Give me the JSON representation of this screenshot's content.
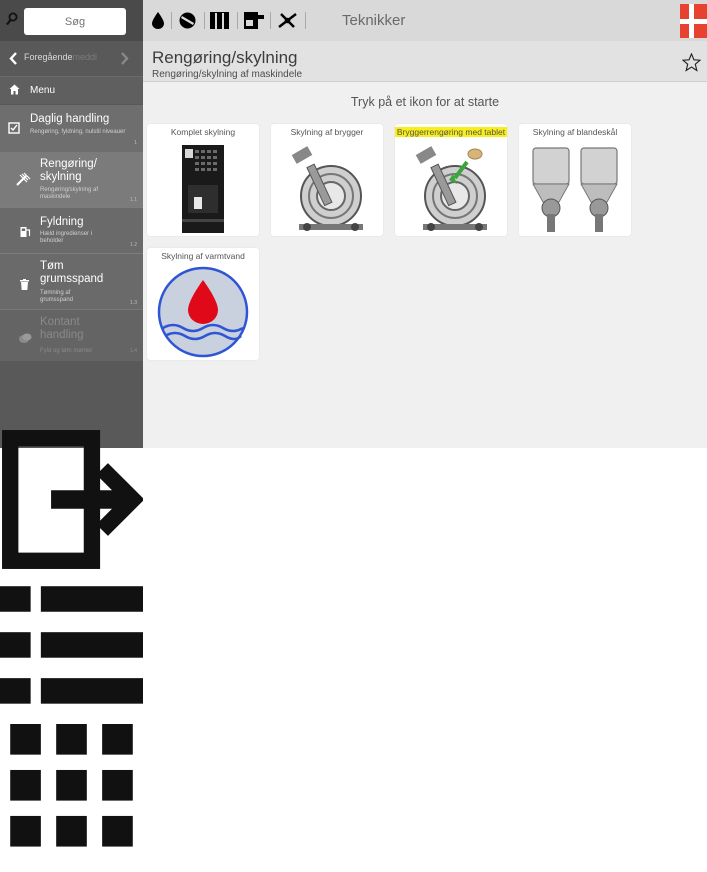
{
  "search": {
    "placeholder": "Søg"
  },
  "nav": {
    "prev_label": "Foregående",
    "prev_suffix": "meddi"
  },
  "menu": {
    "label": "Menu"
  },
  "sidebar": {
    "items": [
      {
        "title": "Daglig handling",
        "sub": "Rengøring, fyldning, nulstil niveauer",
        "num": "1"
      },
      {
        "title": "Rengøring/ skylning",
        "sub": "Rengøring/skylning af maskindele",
        "num": "1.1"
      },
      {
        "title": "Fyldning",
        "sub": "Hæld ingredienser i beholder",
        "num": "1.2"
      },
      {
        "title": "Tøm grumsspand",
        "sub": "Tømning af grumsspand",
        "num": "1.3"
      },
      {
        "title": "Kontant handling",
        "sub": "Fyld og tøm mønter",
        "num": "1.4"
      }
    ]
  },
  "topbar": {
    "title": "Teknikker"
  },
  "page": {
    "title": "Rengøring/skylning",
    "subtitle": "Rengøring/skylning af maskindele",
    "instruction": "Tryk på et ikon for at starte"
  },
  "cards": [
    {
      "label": "Komplet skylning",
      "image": "machine-front"
    },
    {
      "label": "Skylning af brygger",
      "image": "brewer"
    },
    {
      "label": "Bryggerrengøring med tablet",
      "image": "brewer-tablet",
      "highlight_color": "#f8ee1c"
    },
    {
      "label": "Skylning af blandeskål",
      "image": "mixing-bowls"
    },
    {
      "label": "Skylning af varmtvand",
      "image": "water-drop"
    }
  ],
  "colors": {
    "sidebar_bg": "#595959",
    "selected_item_bg": "#7b7b7b",
    "flag_red": "#e6422f",
    "drop_red": "#e0091a",
    "wave_blue": "#2f55d4"
  }
}
